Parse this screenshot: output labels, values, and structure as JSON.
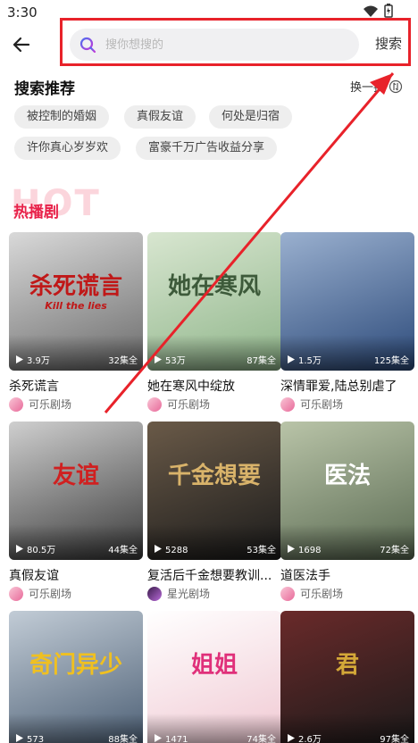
{
  "status_bar": {
    "time": "3:30"
  },
  "header": {
    "search_placeholder": "搜你想搜的",
    "search_button": "搜索"
  },
  "recommend": {
    "title": "搜索推荐",
    "refresh_label": "换一批",
    "tags": [
      "被控制的婚姻",
      "真假友谊",
      "何处是归宿",
      "许你真心岁岁欢",
      "富豪千万广告收益分享"
    ]
  },
  "hot": {
    "bg_text": "HOT",
    "title": "热播剧"
  },
  "dramas": [
    {
      "title": "杀死谎言",
      "views": "3.9万",
      "episodes": "32集全",
      "source": "可乐剧场",
      "poster_text": "杀死谎言",
      "poster_sub": "Kill the lies",
      "color1": "#6b6b6b",
      "color2": "#d9d9d9",
      "text_color": "#c01818"
    },
    {
      "title": "她在寒风中绽放",
      "views": "53万",
      "episodes": "87集全",
      "source": "可乐剧场",
      "poster_text": "她在寒风",
      "poster_sub": "",
      "color1": "#8fb58a",
      "color2": "#d8e6d0",
      "text_color": "#3d5a3a"
    },
    {
      "title": "深情罪爱,陆总别虐了",
      "views": "1.5万",
      "episodes": "125集全",
      "source": "可乐剧场",
      "poster_text": "",
      "poster_sub": "",
      "color1": "#2c4a7a",
      "color2": "#9ab0cf",
      "text_color": "#ffffff"
    },
    {
      "title": "真假友谊",
      "views": "80.5万",
      "episodes": "44集全",
      "source": "可乐剧场",
      "poster_text": "友谊",
      "poster_sub": "",
      "color1": "#3a3a3a",
      "color2": "#cfcfcf",
      "text_color": "#d02020"
    },
    {
      "title": "复活后千金想要教训...",
      "views": "5288",
      "episodes": "53集全",
      "source": "星光剧场",
      "poster_text": "千金想要",
      "poster_sub": "",
      "color1": "#1b1b1b",
      "color2": "#6a5a48",
      "text_color": "#d9b36a"
    },
    {
      "title": "道医法手",
      "views": "1698",
      "episodes": "72集全",
      "source": "可乐剧场",
      "poster_text": "医法",
      "poster_sub": "",
      "color1": "#5a6a52",
      "color2": "#b9c4a8",
      "text_color": "#ffffff"
    },
    {
      "title": "",
      "views": "573",
      "episodes": "88集全",
      "source": "",
      "poster_text": "奇门异少",
      "poster_sub": "",
      "color1": "#4a5d73",
      "color2": "#c2ccd6",
      "text_color": "#f0c020"
    },
    {
      "title": "",
      "views": "1471",
      "episodes": "74集全",
      "source": "",
      "poster_text": "姐姐",
      "poster_sub": "",
      "color1": "#f0c8d2",
      "color2": "#ffffff",
      "text_color": "#e0307a"
    },
    {
      "title": "",
      "views": "2.6万",
      "episodes": "97集全",
      "source": "",
      "poster_text": "君",
      "poster_sub": "",
      "color1": "#1a1a1a",
      "color2": "#6a2a2a",
      "text_color": "#d4a838"
    }
  ],
  "colors": {
    "accent_red": "#e8222a",
    "hot_red": "#e8224a",
    "search_icon": "#7b4fd9"
  }
}
